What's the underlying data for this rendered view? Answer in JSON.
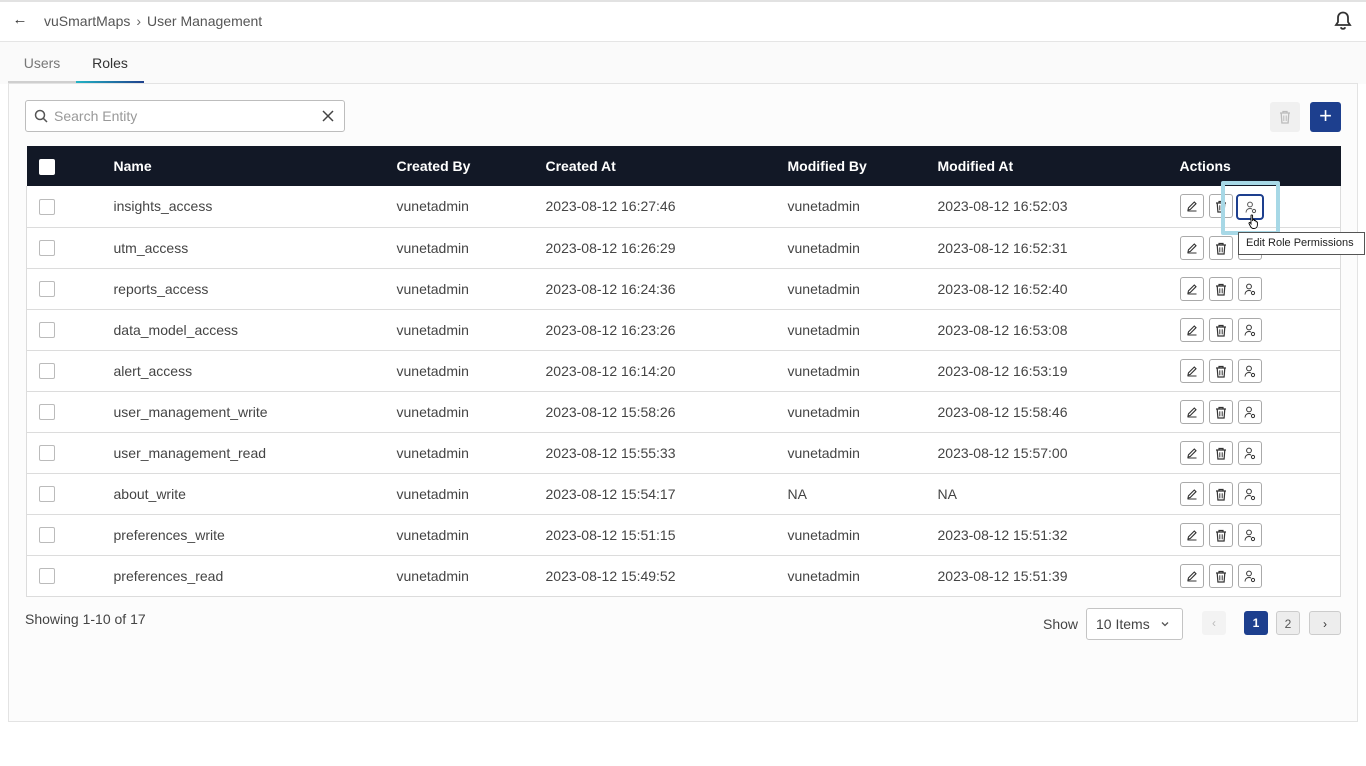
{
  "header": {
    "back_icon": "arrow-left-icon",
    "breadcrumb": [
      "vuSmartMaps",
      "User Management"
    ],
    "bell_icon": "bell-icon"
  },
  "tabs": [
    {
      "label": "Users",
      "active": false
    },
    {
      "label": "Roles",
      "active": true
    }
  ],
  "search": {
    "placeholder": "Search Entity",
    "value": ""
  },
  "toolbar": {
    "add_label": "+"
  },
  "colors": {
    "accent": "#1d3f8e",
    "header_bg": "#121826",
    "highlight": "#a7d8e6"
  },
  "table": {
    "columns": [
      "Name",
      "Created By",
      "Created At",
      "Modified By",
      "Modified At",
      "Actions"
    ],
    "rows": [
      {
        "name": "insights_access",
        "created_by": "vunetadmin",
        "created_at": "2023-08-12 16:27:46",
        "modified_by": "vunetadmin",
        "modified_at": "2023-08-12 16:52:03"
      },
      {
        "name": "utm_access",
        "created_by": "vunetadmin",
        "created_at": "2023-08-12 16:26:29",
        "modified_by": "vunetadmin",
        "modified_at": "2023-08-12 16:52:31"
      },
      {
        "name": "reports_access",
        "created_by": "vunetadmin",
        "created_at": "2023-08-12 16:24:36",
        "modified_by": "vunetadmin",
        "modified_at": "2023-08-12 16:52:40"
      },
      {
        "name": "data_model_access",
        "created_by": "vunetadmin",
        "created_at": "2023-08-12 16:23:26",
        "modified_by": "vunetadmin",
        "modified_at": "2023-08-12 16:53:08"
      },
      {
        "name": "alert_access",
        "created_by": "vunetadmin",
        "created_at": "2023-08-12 16:14:20",
        "modified_by": "vunetadmin",
        "modified_at": "2023-08-12 16:53:19"
      },
      {
        "name": "user_management_write",
        "created_by": "vunetadmin",
        "created_at": "2023-08-12 15:58:26",
        "modified_by": "vunetadmin",
        "modified_at": "2023-08-12 15:58:46"
      },
      {
        "name": "user_management_read",
        "created_by": "vunetadmin",
        "created_at": "2023-08-12 15:55:33",
        "modified_by": "vunetadmin",
        "modified_at": "2023-08-12 15:57:00"
      },
      {
        "name": "about_write",
        "created_by": "vunetadmin",
        "created_at": "2023-08-12 15:54:17",
        "modified_by": "NA",
        "modified_at": "NA"
      },
      {
        "name": "preferences_write",
        "created_by": "vunetadmin",
        "created_at": "2023-08-12 15:51:15",
        "modified_by": "vunetadmin",
        "modified_at": "2023-08-12 15:51:32"
      },
      {
        "name": "preferences_read",
        "created_by": "vunetadmin",
        "created_at": "2023-08-12 15:49:52",
        "modified_by": "vunetadmin",
        "modified_at": "2023-08-12 15:51:39"
      }
    ]
  },
  "tooltip": "Edit Role Permissions",
  "footer": {
    "showing": "Showing 1-10 of 17",
    "show_label": "Show",
    "page_size": "10 Items",
    "pages": [
      "1",
      "2"
    ],
    "current_page": "1"
  }
}
